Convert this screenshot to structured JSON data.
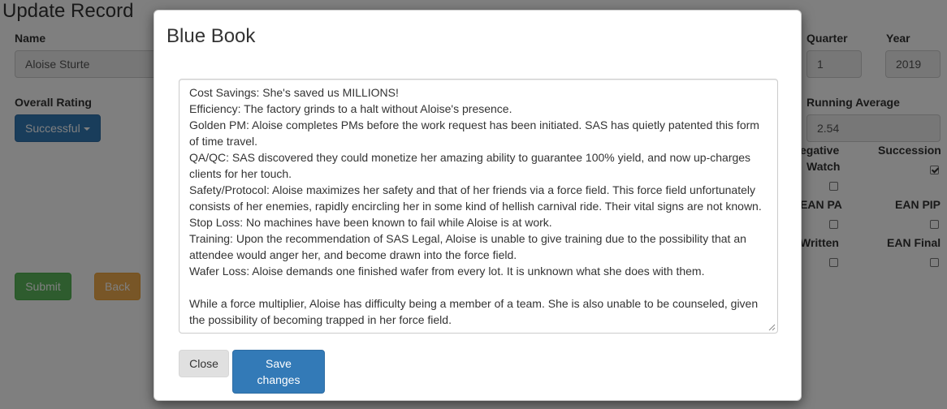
{
  "page": {
    "title": "Update Record",
    "name_label": "Name",
    "name_value": "Aloise Sturte",
    "quarter_label": "Quarter",
    "quarter_value": "1",
    "year_label": "Year",
    "year_value": "2019",
    "overall_rating_label": "Overall Rating",
    "overall_rating_value": "Successful",
    "running_average_label": "Running Average",
    "running_average_value": "2.54",
    "negative_watch_label_1": "egative",
    "negative_watch_label_2": "Watch",
    "negative_watch_checked": false,
    "succession_label": "Succession",
    "succession_checked": true,
    "ean_pa_label": "EAN PA",
    "ean_pa_checked": false,
    "ean_pip_label": "EAN PIP",
    "ean_pip_checked": false,
    "written_label": "Written",
    "written_checked": false,
    "ean_final_label": "EAN Final",
    "ean_final_checked": false,
    "submit_label": "Submit",
    "back_label": "Back"
  },
  "modal": {
    "title": "Blue Book",
    "lines": [
      "Cost Savings: She's saved us MILLIONS!",
      "Efficiency: The factory grinds to a halt without Aloise's presence.",
      "Golden PM: Aloise completes PMs before the work request has been initiated. SAS has quietly patented this form",
      "of time travel.",
      "QA/QC: SAS discovered they could monetize her amazing ability to guarantee 100% yield, and now up-charges",
      "clients for her touch.",
      "Safety/Protocol: Aloise maximizes her safety and that of her friends via a force field. This force field unfortunately",
      "consists of her enemies, rapidly encircling her in some kind of hellish carnival ride. Their vital signs are not known.",
      "Stop Loss: No machines have been known to fail while Aloise is at work.",
      "Training: Upon the recommendation of SAS Legal, Aloise is unable to give training due to the possibility that an",
      "attendee would anger her, and become drawn into the force field.",
      "Wafer Loss: Aloise demands one finished wafer from every lot. It is unknown what she does with them.",
      "",
      "While a force multiplier, Aloise has difficulty being a member of a team. She is also unable to be counseled, given",
      "the possibility of becoming trapped in her force field."
    ],
    "close_label": "Close",
    "save_label": "Save changes"
  },
  "colors": {
    "primary": "#337ab7",
    "success": "#5cb85c",
    "warning": "#f0ad4e",
    "backdrop": "rgba(0,0,0,0.5)"
  }
}
